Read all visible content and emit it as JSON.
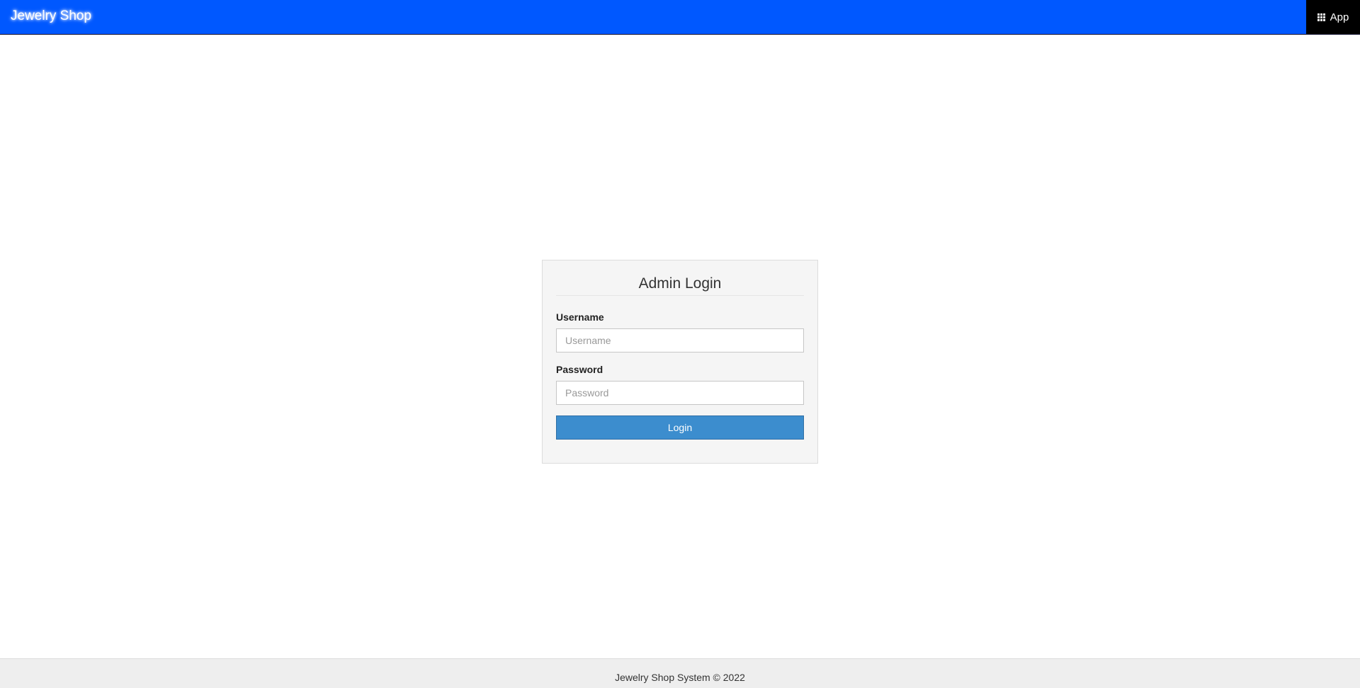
{
  "navbar": {
    "brand": "Jewelry Shop",
    "app_menu_label": "App",
    "app_menu_icon": "grid-icon",
    "background_color": "#0058ff"
  },
  "login": {
    "title": "Admin Login",
    "username_label": "Username",
    "username_placeholder": "Username",
    "username_value": "",
    "password_label": "Password",
    "password_placeholder": "Password",
    "password_value": "",
    "submit_label": "Login",
    "button_color": "#3c8dce"
  },
  "footer": {
    "text": "Jewelry Shop System © 2022"
  }
}
